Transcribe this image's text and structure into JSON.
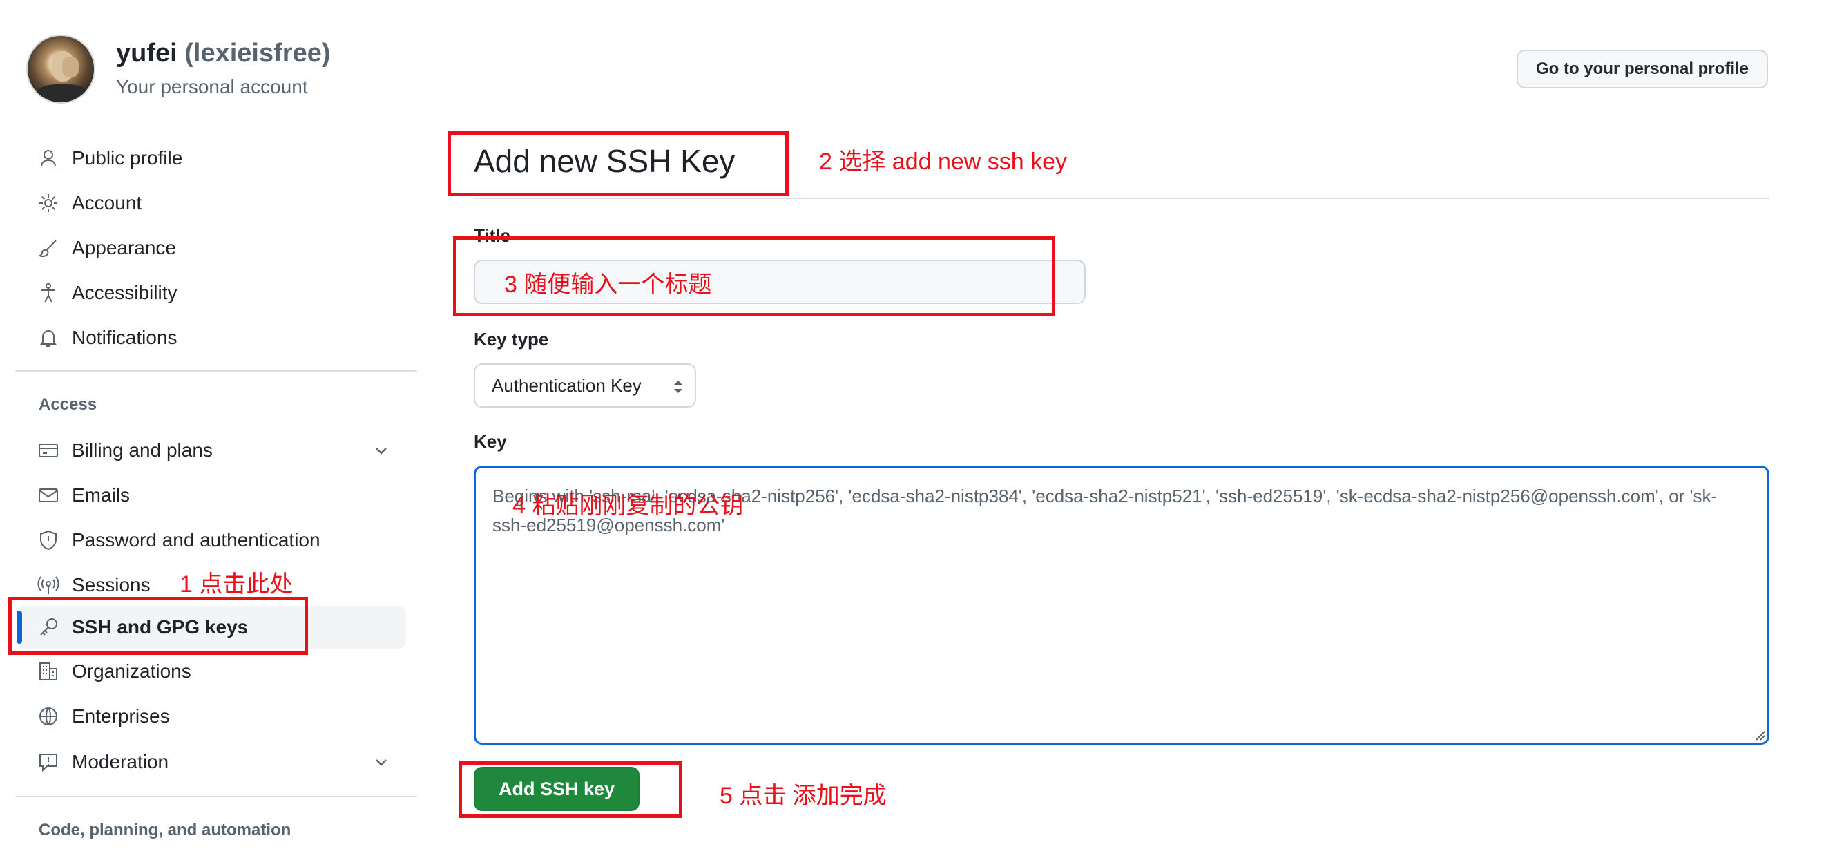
{
  "header": {
    "name": "yufei",
    "handle": "(lexieisfree)",
    "subtitle": "Your personal account",
    "profile_button": "Go to your personal profile"
  },
  "sidebar": {
    "items_top": [
      {
        "label": "Public profile",
        "icon": "person-icon"
      },
      {
        "label": "Account",
        "icon": "gear-icon"
      },
      {
        "label": "Appearance",
        "icon": "paintbrush-icon"
      },
      {
        "label": "Accessibility",
        "icon": "accessibility-icon"
      },
      {
        "label": "Notifications",
        "icon": "bell-icon"
      }
    ],
    "access_heading": "Access",
    "items_access": [
      {
        "label": "Billing and plans",
        "icon": "credit-card-icon"
      },
      {
        "label": "Emails",
        "icon": "mail-icon"
      },
      {
        "label": "Password and authentication",
        "icon": "shield-icon"
      },
      {
        "label": "Sessions",
        "icon": "broadcast-icon"
      },
      {
        "label": "SSH and GPG keys",
        "icon": "key-icon",
        "active": true
      },
      {
        "label": "Organizations",
        "icon": "organization-icon"
      },
      {
        "label": "Enterprises",
        "icon": "globe-icon"
      },
      {
        "label": "Moderation",
        "icon": "report-icon"
      }
    ],
    "code_heading": "Code, planning, and automation"
  },
  "main": {
    "title": "Add new SSH Key",
    "title_label": "Title",
    "title_value": "",
    "key_type_label": "Key type",
    "key_type_selected": "Authentication Key",
    "key_label": "Key",
    "key_placeholder": "Begins with 'ssh-rsa', 'ecdsa-sha2-nistp256', 'ecdsa-sha2-nistp384', 'ecdsa-sha2-nistp521', 'ssh-ed25519', 'sk-ecdsa-sha2-nistp256@openssh.com', or 'sk-ssh-ed25519@openssh.com'",
    "submit_label": "Add SSH key"
  },
  "annotations": {
    "step1": "1 点击此处",
    "step2": "2 选择 add new ssh key",
    "step3": "3 随便输入一个标题",
    "step4": "4 粘贴刚刚复制的公钥",
    "step5": "5 点击 添加完成"
  },
  "colors": {
    "accent": "#0969da",
    "primary_button": "#1f883d",
    "annotation": "#e8101b"
  }
}
